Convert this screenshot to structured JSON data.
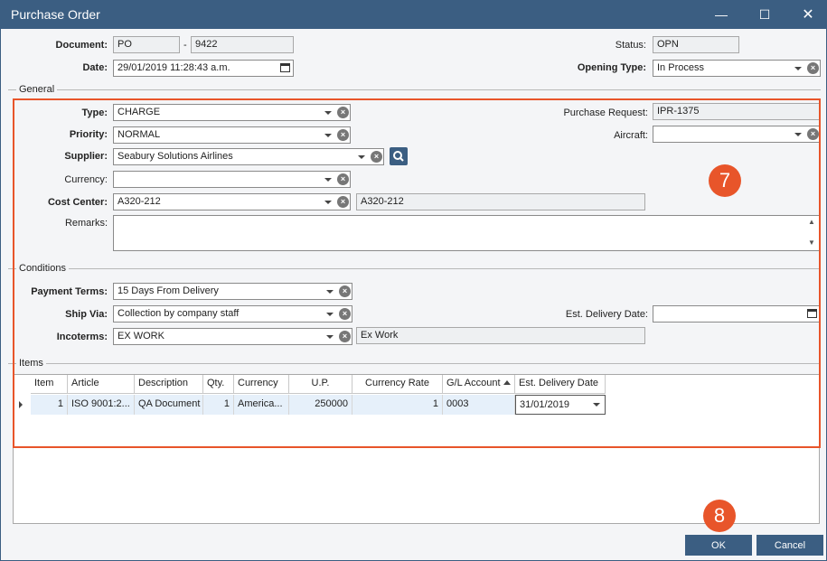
{
  "window": {
    "title": "Purchase Order"
  },
  "header": {
    "document_label": "Document:",
    "document_prefix": "PO",
    "document_separator": "-",
    "document_number": "9422",
    "date_label": "Date:",
    "date_value": "29/01/2019 11:28:43 a.m.",
    "status_label": "Status:",
    "status_value": "OPN",
    "opening_type_label": "Opening Type:",
    "opening_type_value": "In Process"
  },
  "general": {
    "title": "General",
    "type_label": "Type:",
    "type_value": "CHARGE",
    "priority_label": "Priority:",
    "priority_value": "NORMAL",
    "supplier_label": "Supplier:",
    "supplier_value": "Seabury Solutions Airlines",
    "currency_label": "Currency:",
    "currency_value": "",
    "cost_center_label": "Cost Center:",
    "cost_center_value": "A320-212",
    "cost_center_desc": "A320-212",
    "remarks_label": "Remarks:",
    "remarks_value": "",
    "purchase_request_label": "Purchase Request:",
    "purchase_request_value": "IPR-1375",
    "aircraft_label": "Aircraft:",
    "aircraft_value": ""
  },
  "conditions": {
    "title": "Conditions",
    "payment_terms_label": "Payment Terms:",
    "payment_terms_value": "15 Days From Delivery",
    "ship_via_label": "Ship Via:",
    "ship_via_value": "Collection by company staff",
    "incoterms_label": "Incoterms:",
    "incoterms_value": "EX WORK",
    "incoterms_desc": "Ex Work",
    "est_delivery_label": "Est. Delivery Date:",
    "est_delivery_value": ""
  },
  "items": {
    "title": "Items",
    "columns": [
      "Item",
      "Article",
      "Description",
      "Qty.",
      "Currency",
      "U.P.",
      "Currency Rate",
      "G/L Account",
      "Est. Delivery Date"
    ],
    "rows": [
      [
        "1",
        "ISO 9001:2...",
        "QA Document",
        "1",
        "America...",
        "250000",
        "1",
        "0003",
        "31/01/2019"
      ]
    ]
  },
  "annotations": {
    "badge_7": "7",
    "badge_8": "8"
  },
  "buttons": {
    "ok": "OK",
    "cancel": "Cancel"
  },
  "colors": {
    "titlebar": "#3b5e82",
    "highlight": "#e8552a",
    "selected_row": "#e6f0fa"
  }
}
